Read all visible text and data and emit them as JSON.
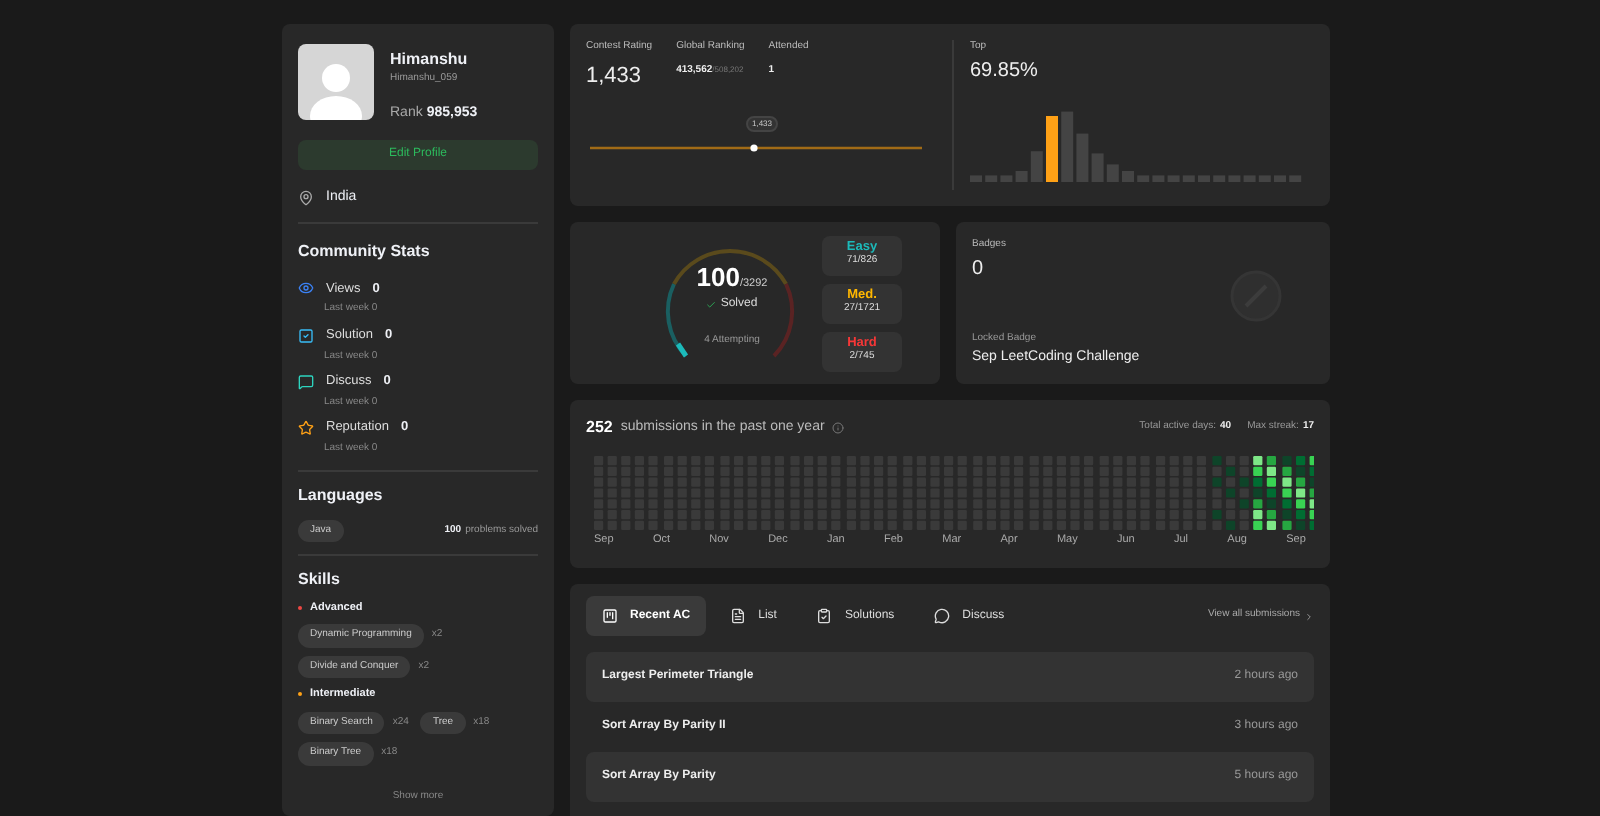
{
  "profile": {
    "name": "Himanshu",
    "handle": "Himanshu_059",
    "rank_label": "Rank",
    "rank": "985,953",
    "edit_button": "Edit Profile",
    "location": "India"
  },
  "community_stats": {
    "title": "Community Stats",
    "items": [
      {
        "kind": "views",
        "label": "Views",
        "value": "0",
        "sub": "Last week 0"
      },
      {
        "kind": "solution",
        "label": "Solution",
        "value": "0",
        "sub": "Last week 0"
      },
      {
        "kind": "discuss",
        "label": "Discuss",
        "value": "0",
        "sub": "Last week 0"
      },
      {
        "kind": "reputation",
        "label": "Reputation",
        "value": "0",
        "sub": "Last week 0"
      }
    ]
  },
  "languages": {
    "title": "Languages",
    "items": [
      {
        "name": "Java",
        "count": "100",
        "suffix": "problems solved"
      }
    ]
  },
  "skills": {
    "title": "Skills",
    "groups": [
      {
        "level": "Advanced",
        "color": "#ef4743",
        "tags": [
          {
            "name": "Dynamic Programming",
            "count": "x2"
          },
          {
            "name": "Divide and Conquer",
            "count": "x2"
          }
        ]
      },
      {
        "level": "Intermediate",
        "color": "#ffa116",
        "tags": [
          {
            "name": "Binary Search",
            "count": "x24"
          },
          {
            "name": "Tree",
            "count": "x18"
          },
          {
            "name": "Binary Tree",
            "count": "x18"
          }
        ]
      }
    ],
    "show_more": "Show more"
  },
  "contest": {
    "stats": [
      {
        "label": "Contest Rating",
        "value": "1,433"
      },
      {
        "label": "Global Ranking",
        "value": "413,562",
        "total": "/508,202"
      },
      {
        "label": "Attended",
        "value": "1"
      }
    ],
    "point_label": "1,433",
    "top_label": "Top",
    "top_value": "69.85%"
  },
  "solved": {
    "count": "100",
    "total": "/3292",
    "label": "Solved",
    "attempting": "4 Attempting",
    "levels": [
      {
        "name": "Easy",
        "value": "71/826",
        "color": "#1cbaba"
      },
      {
        "name": "Med.",
        "value": "27/1721",
        "color": "#ffb700"
      },
      {
        "name": "Hard",
        "value": "2/745",
        "color": "#f63737"
      }
    ]
  },
  "badges": {
    "title": "Badges",
    "count": "0",
    "locked_label": "Locked Badge",
    "locked_name": "Sep LeetCoding Challenge"
  },
  "submissions": {
    "count": "252",
    "text": "submissions in the past one year",
    "active_label": "Total active days:",
    "active_value": "40",
    "streak_label": "Max streak:",
    "streak_value": "17",
    "months": [
      "Sep",
      "Oct",
      "Nov",
      "Dec",
      "Jan",
      "Feb",
      "Mar",
      "Apr",
      "May",
      "Jun",
      "Jul",
      "Aug",
      "Sep"
    ]
  },
  "recent": {
    "tabs": [
      {
        "kind": "recent",
        "label": "Recent AC",
        "selected": true
      },
      {
        "kind": "list",
        "label": "List",
        "selected": false
      },
      {
        "kind": "solutions",
        "label": "Solutions",
        "selected": false
      },
      {
        "kind": "discuss",
        "label": "Discuss",
        "selected": false
      }
    ],
    "view_all": "View all submissions",
    "rows": [
      {
        "title": "Largest Perimeter Triangle",
        "time": "2 hours ago"
      },
      {
        "title": "Sort Array By Parity II",
        "time": "3 hours ago"
      },
      {
        "title": "Sort Array By Parity",
        "time": "5 hours ago"
      }
    ]
  }
}
